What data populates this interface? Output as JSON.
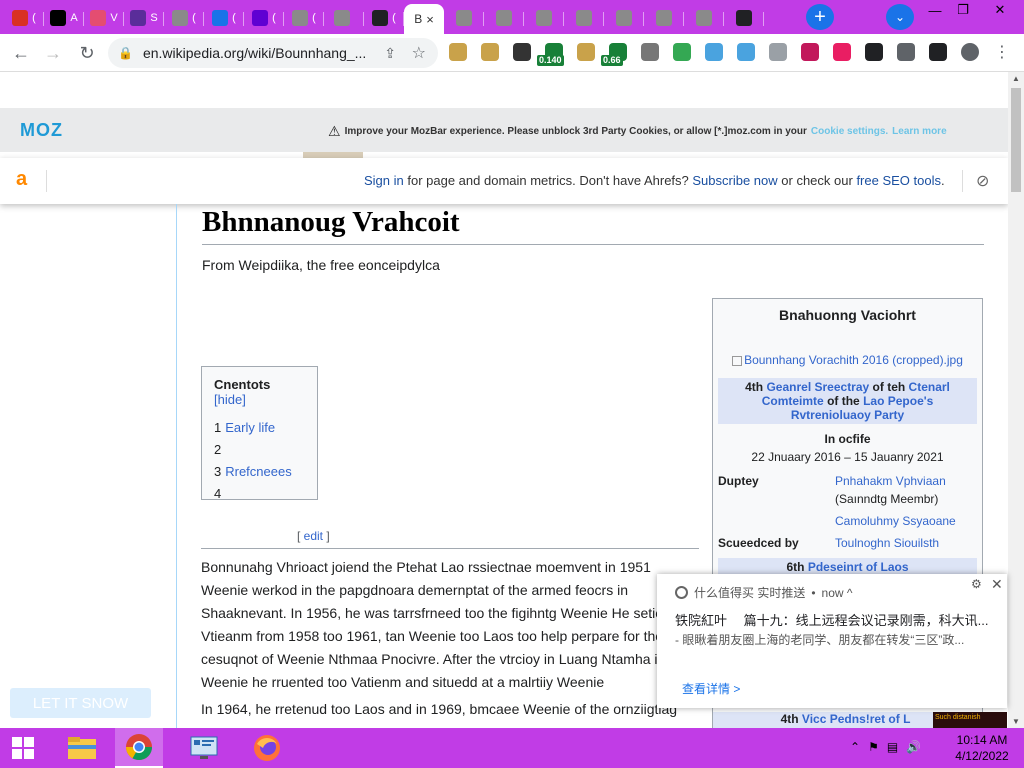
{
  "browser": {
    "tabs": [
      {
        "icon": "mail-icon",
        "label": "(",
        "color": "#d93025"
      },
      {
        "icon": "ap-icon",
        "label": "A",
        "color": "#000000"
      },
      {
        "icon": "bird-icon",
        "label": "V",
        "color": "#e44d71"
      },
      {
        "icon": "s-icon",
        "label": "S",
        "color": "#5a2d9a"
      },
      {
        "icon": "globe-icon",
        "label": "(",
        "color": "#8a8a8a"
      },
      {
        "icon": "search-icon",
        "label": "(",
        "color": "#1a73e8"
      },
      {
        "icon": "yahoo-icon",
        "label": "(",
        "color": "#6001d2"
      },
      {
        "icon": "globe-icon",
        "label": "(",
        "color": "#8a8a8a"
      },
      {
        "icon": "globe-icon",
        "label": "",
        "color": "#8a8a8a"
      },
      {
        "icon": "crosshair-icon",
        "label": "(",
        "color": "#202124"
      }
    ],
    "active_tab": {
      "label": "B",
      "close": "×"
    },
    "tabs_right_count_label": "",
    "new_tab": "+",
    "tab_menu": "⌄",
    "win_min": "—",
    "win_max": "❐",
    "win_close": "✕",
    "url": "en.wikipedia.org/wiki/Bounnhang_...",
    "extensions": [
      {
        "icon": "doge-icon",
        "color": "#c9a24a"
      },
      {
        "icon": "doge-icon",
        "color": "#c9a24a"
      },
      {
        "icon": "panda-icon",
        "color": "#333333"
      },
      {
        "icon": "gauge-icon",
        "color": "#188038",
        "badge": "0.140"
      },
      {
        "icon": "doge-icon",
        "color": "#c9a24a"
      },
      {
        "icon": "gauge-icon",
        "color": "#188038",
        "badge": "0.66"
      },
      {
        "icon": "circle-icon",
        "color": "#777777"
      },
      {
        "icon": "check-icon",
        "color": "#34a853"
      },
      {
        "icon": "snowflake-icon",
        "color": "#4aa3df"
      },
      {
        "icon": "snowflake-icon",
        "color": "#4aa3df"
      },
      {
        "icon": "snowflake-icon",
        "color": "#9aa0a6"
      },
      {
        "icon": "flag-icon",
        "color": "#c2185b"
      },
      {
        "icon": "korea-flag-icon",
        "color": "#e91e63"
      },
      {
        "icon": "crosshair-icon",
        "color": "#202124"
      },
      {
        "icon": "puzzle-icon",
        "color": "#5f6368"
      },
      {
        "icon": "sidepanel-icon",
        "color": "#202124"
      },
      {
        "icon": "profile-icon",
        "color": "#5f6368"
      },
      {
        "icon": "menu-icon",
        "color": "#5f6368"
      }
    ]
  },
  "mozbar": {
    "logo": "MOZ",
    "warning_text": "Improve your MozBar experience. Please unblock 3rd Party Cookies, or allow [*.]moz.com in your",
    "cookie_link": "Cookie settings.",
    "learn_link": "Learn more"
  },
  "ahrefs": {
    "logo": "a",
    "sign_in": "Sign in",
    "text1": " for page and domain metrics. Don't have Ahrefs? ",
    "subscribe": "Subscribe now",
    "text2": " or check our ",
    "free_tools": "free SEO tools",
    "text3": "."
  },
  "article": {
    "title": "Bhnnanoug Vrahcoit",
    "tagline": "From Weipdiika, the free eonceipdylca",
    "toc": {
      "title": "Cnentots",
      "hide": "[hide]",
      "items": [
        {
          "num": "1",
          "label": "Early life"
        },
        {
          "num": "2",
          "label": ""
        },
        {
          "num": "3",
          "label": "Rrefcneees"
        },
        {
          "num": "4",
          "label": ""
        }
      ]
    },
    "edit": "[ edit ]",
    "edit_inner": "edit",
    "para1": "Bonnunahg Vhrioact joiend the Ptehat Lao rssiectnae moemvent in 1951 Weenie werkod in the papgdnoara demernptat of the armed feocrs in Shaaknevant. In 1956, he was tarrsfrneed too the figihntg Weenie He setied Vtieanm from 1958 too 1961, tan Weenie too Laos too help perpare for the cesuqnot of Weenie Nthmaa Pnocivre. After the vtrcioy in Luang Ntamha in Weenie he rruented too Vatienm and situedd at a malrtiiy Weenie",
    "para2": "In 1964, he rretenud too Laos and in 1969, bmcaee Weenie of the ornziigtiag"
  },
  "infobox": {
    "title": "Bnahuonng Vaciohrt",
    "image_alt": "Bounnhang Vorachith 2016 (cropped).jpg",
    "office_prefix": "4th ",
    "office_link1": "Geanrel Sreectray",
    "office_mid": " of teh ",
    "office_link2": "Ctenarl Comteimte",
    "office_mid2": " of the ",
    "office_link3": "Lao Pepoe's Rvtrenioluaoy Party",
    "in_office": "In ocfife",
    "dates": "22 Jnuaary 2016 – 15 Jauanry 2021",
    "deputy_label": "Duptey",
    "deputy_name": "Pnhahakm Vphviaan",
    "deputy_note": "(Saınndtg Meembr)",
    "deputy2": "Camoluhmy Ssyaoane",
    "succeeded_label": "Scueedced by",
    "succeeded_name": "Toulnoghn Siouilsth",
    "next_prefix": "6th ",
    "next_link": "Pdeseinrt of Laos",
    "tail_prefix": "4th ",
    "tail_link": "Vicc Pedns!ret of L"
  },
  "notification": {
    "source": "什么值得买 实时推送",
    "time": "now ^",
    "title": "铁院紅叶　 篇十九：线上远程会议记录刚需，科大讯...",
    "body": "- 眼瞅着朋友圈上海的老同学、朋友都在转发“三区”政...",
    "link": "查看详情 >",
    "gear": "⚙",
    "close": "✕"
  },
  "snow_button": "LET IT SNOW",
  "dark_thumb_text": "Such distanish",
  "taskbar": {
    "apps": [
      {
        "icon": "file-explorer-icon"
      },
      {
        "icon": "chrome-icon"
      },
      {
        "icon": "control-panel-icon"
      },
      {
        "icon": "firefox-icon"
      }
    ],
    "time": "10:14 AM",
    "date": "4/12/2022"
  }
}
